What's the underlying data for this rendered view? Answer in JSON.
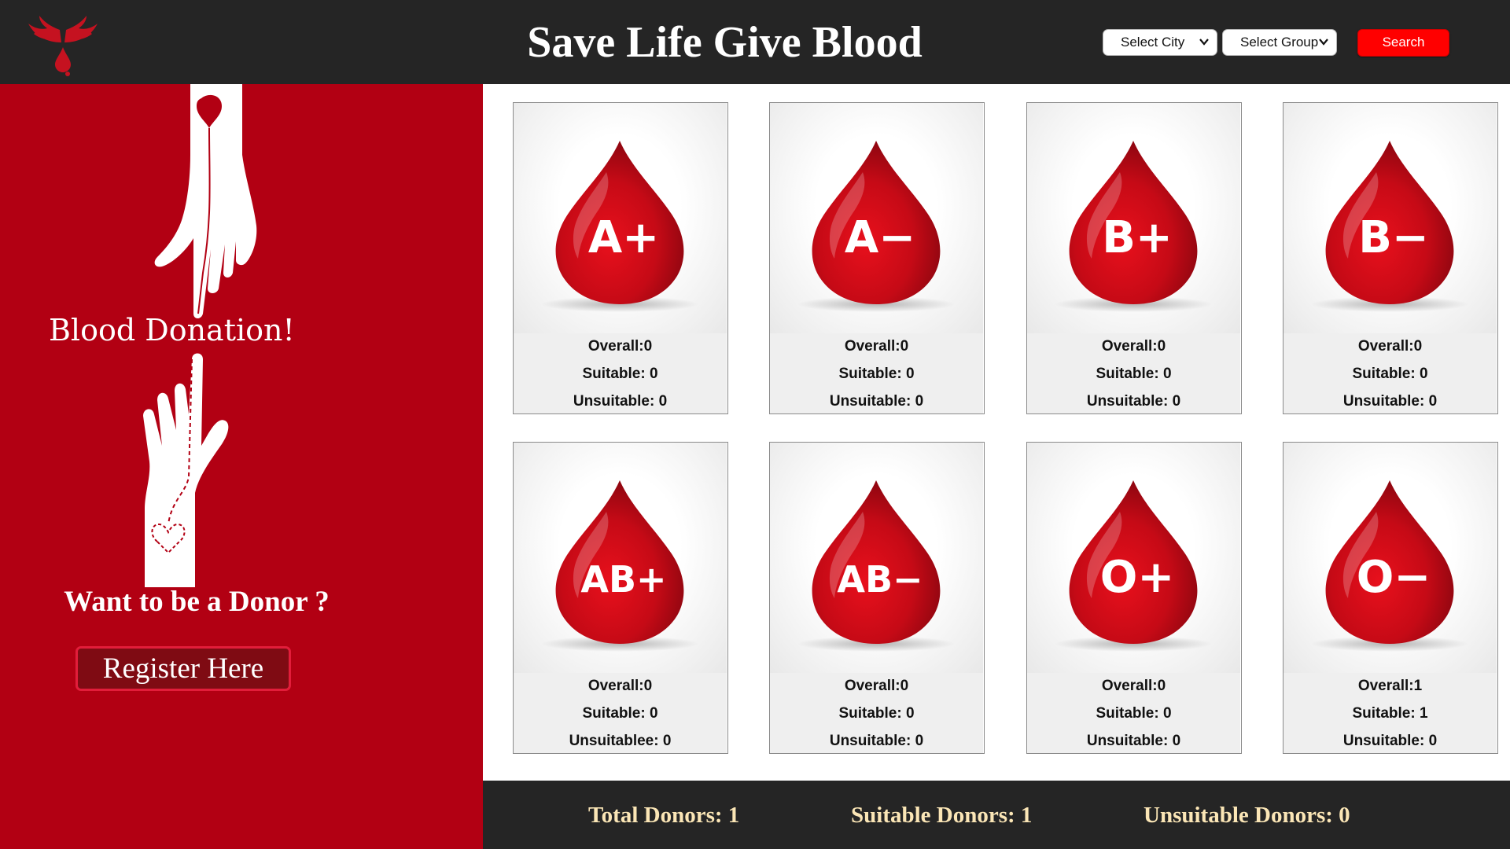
{
  "header": {
    "title": "Save Life Give Blood",
    "city_select": "Select City",
    "group_select": "Select Group",
    "search_label": "Search",
    "logo_icon": "wings-blood-drop-logo"
  },
  "left_panel": {
    "illustration_text": "Blood Donation!",
    "promo_text": "Want to be a Donor ?",
    "register_label": "Register Here",
    "background_color": "#b20013"
  },
  "blood_groups": [
    {
      "group": "A+",
      "overall": "Overall:0",
      "suitable": "Suitable: 0",
      "unsuitable": "Unsuitable: 0"
    },
    {
      "group": "A−",
      "overall": "Overall:0",
      "suitable": "Suitable: 0",
      "unsuitable": "Unsuitable: 0"
    },
    {
      "group": "B+",
      "overall": "Overall:0",
      "suitable": "Suitable: 0",
      "unsuitable": "Unsuitable: 0"
    },
    {
      "group": "B−",
      "overall": "Overall:0",
      "suitable": "Suitable: 0",
      "unsuitable": "Unsuitable: 0"
    },
    {
      "group": "AB+",
      "overall": "Overall:0",
      "suitable": "Suitable: 0",
      "unsuitable": "Unsuitablee: 0"
    },
    {
      "group": "AB−",
      "overall": "Overall:0",
      "suitable": "Suitable: 0",
      "unsuitable": "Unsuitable: 0"
    },
    {
      "group": "O+",
      "overall": "Overall:0",
      "suitable": "Suitable: 0",
      "unsuitable": "Unsuitable: 0"
    },
    {
      "group": "O−",
      "overall": "Overall:1",
      "suitable": "Suitable: 1",
      "unsuitable": "Unsuitable: 0"
    }
  ],
  "footer": {
    "total": "Total Donors: 1",
    "suitable": "Suitable Donors: 1",
    "unsuitable": "Unsuitable Donors: 0"
  },
  "colors": {
    "header_bg": "#252525",
    "accent_red": "#ff0000",
    "panel_red": "#b20013",
    "footer_text": "#fbe6b6"
  }
}
